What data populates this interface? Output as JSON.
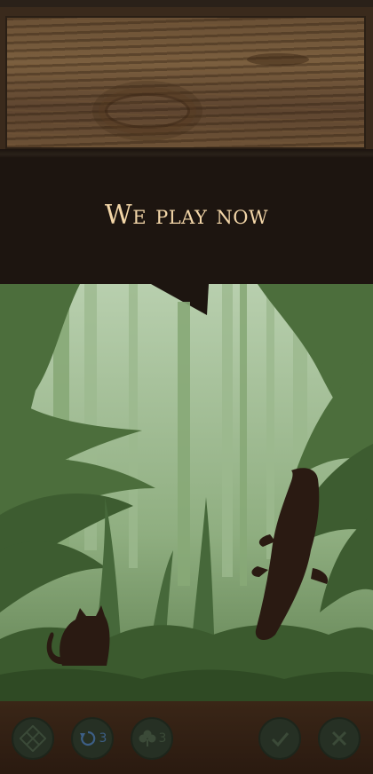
{
  "banner": {
    "title": "We play now"
  },
  "toolbar": {
    "undo_count": "3",
    "hint_count": "3"
  },
  "icons": {
    "grid": "dice-grid-icon",
    "undo": "undo-icon",
    "hint": "clover-icon",
    "confirm": "check-icon",
    "cancel": "close-icon"
  },
  "colors": {
    "banner_bg": "#1d1510",
    "title_text": "#f3d6a8",
    "jungle_light": "#a9c29b",
    "jungle_dark": "#2f4a24",
    "silhouette": "#2a1a12",
    "button_bg": "#263024"
  }
}
